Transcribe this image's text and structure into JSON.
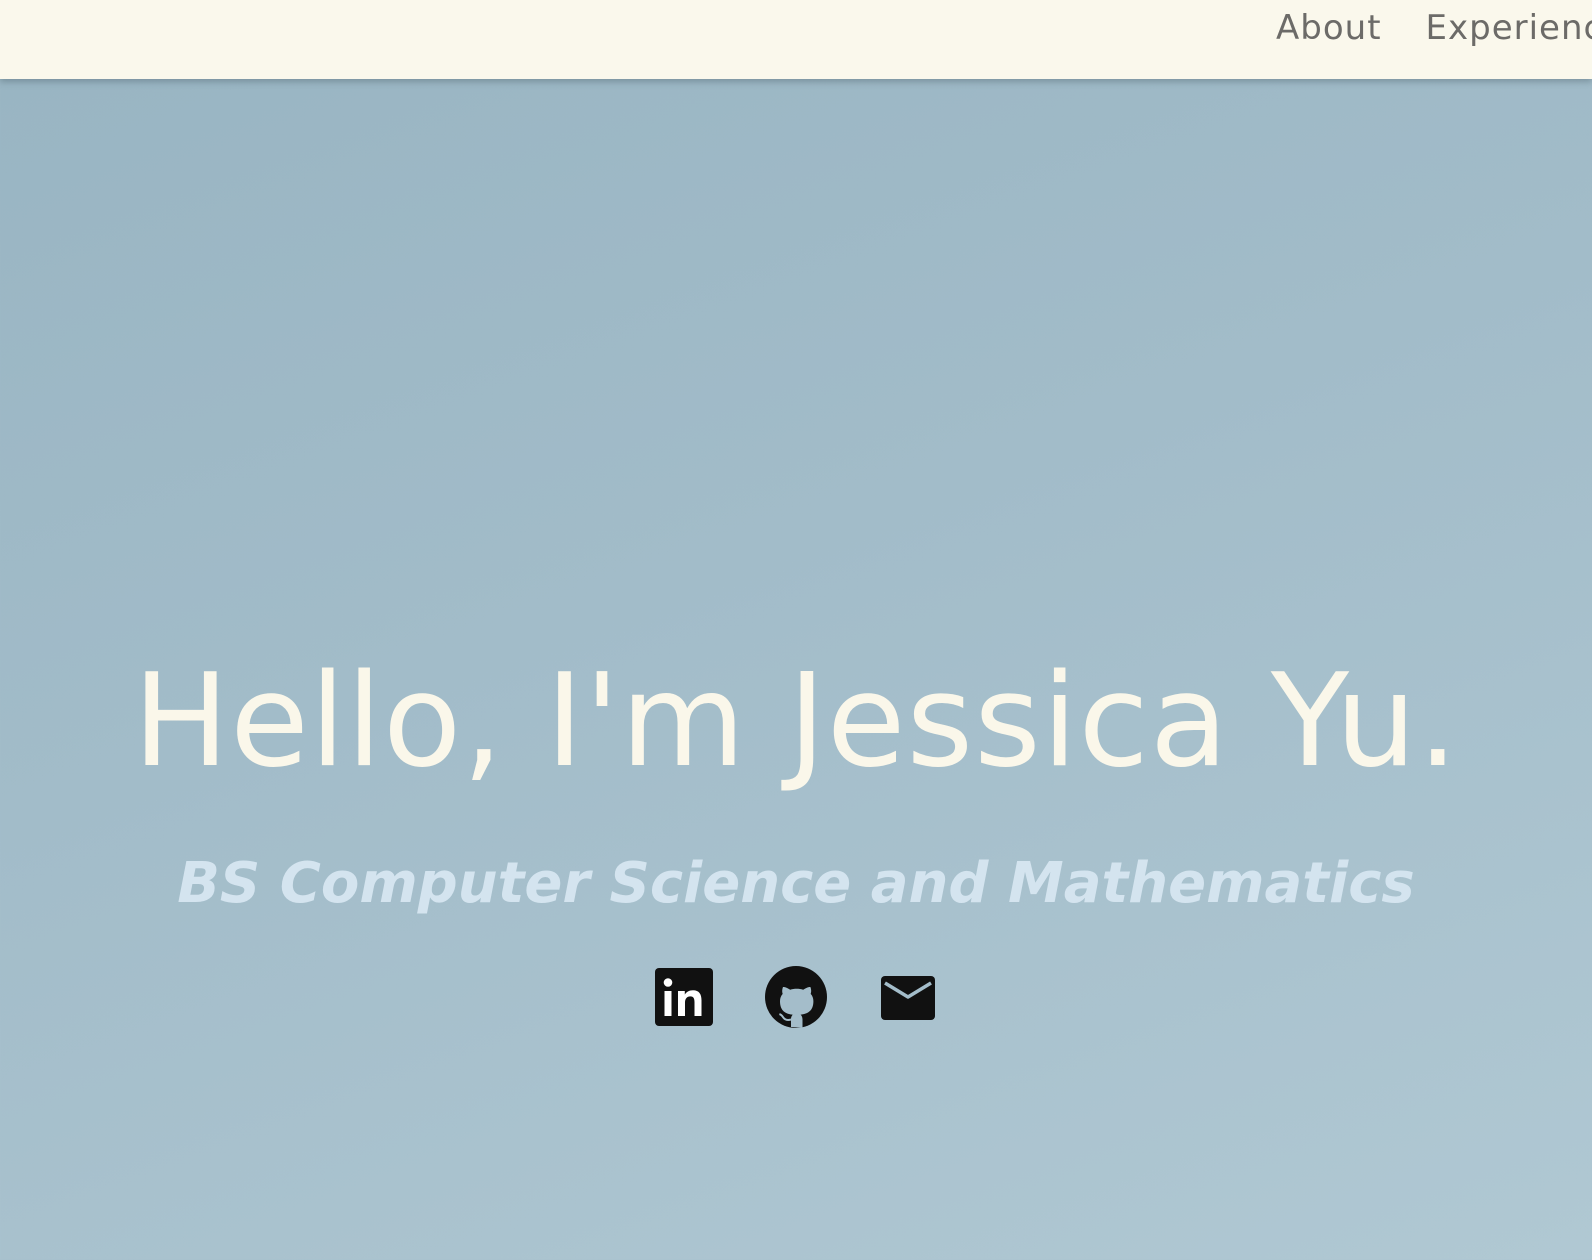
{
  "nav": {
    "links": [
      {
        "label": "About"
      },
      {
        "label": "Experience"
      }
    ]
  },
  "hero": {
    "title": "Hello, I'm Jessica Yu.",
    "subtitle": "BS Computer Science and Mathematics"
  },
  "social": [
    {
      "icon": "linkedin-icon"
    },
    {
      "icon": "github-icon"
    },
    {
      "icon": "mail-icon"
    }
  ],
  "colors": {
    "navbar_bg": "#faf8ec",
    "nav_text": "#6c6b68",
    "hero_bg": "#a2bcc9",
    "title": "#faf7ea",
    "subtitle": "#d4e4ef",
    "icon": "#111111"
  }
}
